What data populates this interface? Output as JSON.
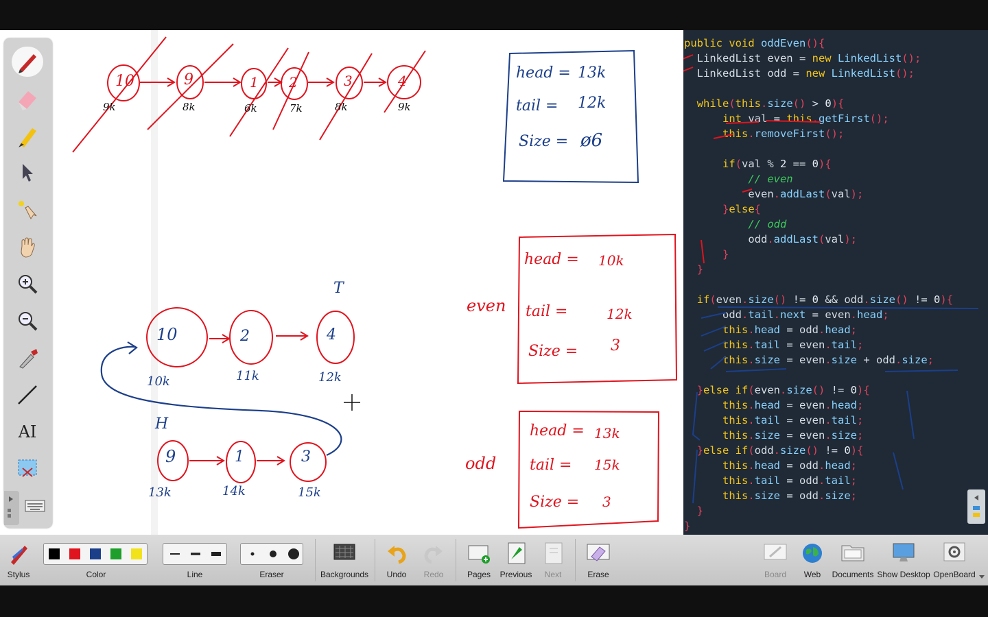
{
  "board": {
    "top_nodes": [
      {
        "value": "10",
        "addr": "9k"
      },
      {
        "value": "9",
        "addr": "8k"
      },
      {
        "value": "1",
        "addr": "6k"
      },
      {
        "value": "2",
        "addr": "7k"
      },
      {
        "value": "3",
        "addr": "8k"
      },
      {
        "value": "4",
        "addr": "9k"
      }
    ],
    "main_box": {
      "head_label": "head =",
      "head_val": "13k",
      "tail_label": "tail =",
      "tail_val": "12k",
      "size_label": "Size =",
      "size_val": "ø6"
    },
    "even_list": {
      "tail_marker": "T",
      "nodes": [
        {
          "value": "10",
          "addr": "10k"
        },
        {
          "value": "2",
          "addr": "11k"
        },
        {
          "value": "4",
          "addr": "12k"
        }
      ]
    },
    "odd_list": {
      "head_marker": "H",
      "nodes": [
        {
          "value": "9",
          "addr": "13k"
        },
        {
          "value": "1",
          "addr": "14k"
        },
        {
          "value": "3",
          "addr": "15k"
        }
      ]
    },
    "even_label": "even",
    "odd_label": "odd",
    "even_box": {
      "head_label": "head =",
      "head_val": "10k",
      "tail_label": "tail =",
      "tail_val": "12k",
      "size_label": "Size =",
      "size_val": "3"
    },
    "odd_box": {
      "head_label": "head =",
      "head_val": "13k",
      "tail_label": "tail =",
      "tail_val": "15k",
      "size_label": "Size =",
      "size_val": "3"
    }
  },
  "palette": {
    "tools": [
      "pen-icon",
      "eraser-icon",
      "marker-icon",
      "pointer-icon",
      "laser-pointer-icon",
      "hand-icon",
      "zoom-in-icon",
      "zoom-out-icon",
      "color-picker-icon",
      "line-icon",
      "text-icon",
      "capture-icon",
      "keyboard-icon"
    ],
    "text_tool_glyph": "AI"
  },
  "code": {
    "lines": [
      [
        [
          "kw",
          "public "
        ],
        [
          "ty",
          "void "
        ],
        [
          "fn",
          "oddEven"
        ],
        [
          "pu",
          "(){"
        ]
      ],
      [
        [
          "",
          "  LinkedList even = "
        ],
        [
          "kw",
          "new "
        ],
        [
          "fn",
          "LinkedList"
        ],
        [
          "pu",
          "();"
        ]
      ],
      [
        [
          "",
          "  LinkedList odd = "
        ],
        [
          "kw",
          "new "
        ],
        [
          "fn",
          "LinkedList"
        ],
        [
          "pu",
          "();"
        ]
      ],
      [
        [
          "",
          ""
        ]
      ],
      [
        [
          "kw",
          "  while"
        ],
        [
          "pu",
          "("
        ],
        [
          "kw",
          "this"
        ],
        [
          "pu",
          "."
        ],
        [
          "fn",
          "size"
        ],
        [
          "pu",
          "() "
        ],
        [
          "",
          "> "
        ],
        [
          "nu",
          "0"
        ],
        [
          "pu",
          "){"
        ]
      ],
      [
        [
          "ty",
          "      int "
        ],
        [
          "",
          "val = "
        ],
        [
          "kw",
          "this"
        ],
        [
          "pu",
          "."
        ],
        [
          "fn",
          "getFirst"
        ],
        [
          "pu",
          "();"
        ]
      ],
      [
        [
          "kw",
          "      this"
        ],
        [
          "pu",
          "."
        ],
        [
          "fn",
          "removeFirst"
        ],
        [
          "pu",
          "();"
        ]
      ],
      [
        [
          "",
          ""
        ]
      ],
      [
        [
          "kw",
          "      if"
        ],
        [
          "pu",
          "("
        ],
        [
          "",
          "val % "
        ],
        [
          "nu",
          "2"
        ],
        [
          "",
          " == "
        ],
        [
          "nu",
          "0"
        ],
        [
          "pu",
          "){"
        ]
      ],
      [
        [
          "cm",
          "          // even"
        ]
      ],
      [
        [
          "",
          "          even"
        ],
        [
          "pu",
          "."
        ],
        [
          "fn",
          "addLast"
        ],
        [
          "pu",
          "("
        ],
        [
          "",
          "val"
        ],
        [
          "pu",
          ");"
        ]
      ],
      [
        [
          "pu",
          "      }"
        ],
        [
          "kw",
          "else"
        ],
        [
          "pu",
          "{"
        ]
      ],
      [
        [
          "cm",
          "          // odd"
        ]
      ],
      [
        [
          "",
          "          odd"
        ],
        [
          "pu",
          "."
        ],
        [
          "fn",
          "addLast"
        ],
        [
          "pu",
          "("
        ],
        [
          "",
          "val"
        ],
        [
          "pu",
          ");"
        ]
      ],
      [
        [
          "pu",
          "      }"
        ]
      ],
      [
        [
          "pu",
          "  }"
        ]
      ],
      [
        [
          "",
          ""
        ]
      ],
      [
        [
          "kw",
          "  if"
        ],
        [
          "pu",
          "("
        ],
        [
          "",
          "even"
        ],
        [
          "pu",
          "."
        ],
        [
          "fn",
          "size"
        ],
        [
          "pu",
          "() "
        ],
        [
          "",
          "!= "
        ],
        [
          "nu",
          "0"
        ],
        [
          "",
          " && odd"
        ],
        [
          "pu",
          "."
        ],
        [
          "fn",
          "size"
        ],
        [
          "pu",
          "() "
        ],
        [
          "",
          "!= "
        ],
        [
          "nu",
          "0"
        ],
        [
          "pu",
          "){"
        ]
      ],
      [
        [
          "",
          "      odd"
        ],
        [
          "pu",
          "."
        ],
        [
          "fn",
          "tail"
        ],
        [
          "pu",
          "."
        ],
        [
          "fn",
          "next"
        ],
        [
          "",
          " = even"
        ],
        [
          "pu",
          "."
        ],
        [
          "fn",
          "head"
        ],
        [
          "pu",
          ";"
        ]
      ],
      [
        [
          "kw",
          "      this"
        ],
        [
          "pu",
          "."
        ],
        [
          "fn",
          "head"
        ],
        [
          "",
          " = odd"
        ],
        [
          "pu",
          "."
        ],
        [
          "fn",
          "head"
        ],
        [
          "pu",
          ";"
        ]
      ],
      [
        [
          "kw",
          "      this"
        ],
        [
          "pu",
          "."
        ],
        [
          "fn",
          "tail"
        ],
        [
          "",
          " = even"
        ],
        [
          "pu",
          "."
        ],
        [
          "fn",
          "tail"
        ],
        [
          "pu",
          ";"
        ]
      ],
      [
        [
          "kw",
          "      this"
        ],
        [
          "pu",
          "."
        ],
        [
          "fn",
          "size"
        ],
        [
          "",
          " = even"
        ],
        [
          "pu",
          "."
        ],
        [
          "fn",
          "size"
        ],
        [
          "",
          " + odd"
        ],
        [
          "pu",
          "."
        ],
        [
          "fn",
          "size"
        ],
        [
          "pu",
          ";"
        ]
      ],
      [
        [
          "",
          ""
        ]
      ],
      [
        [
          "pu",
          "  }"
        ],
        [
          "kw",
          "else if"
        ],
        [
          "pu",
          "("
        ],
        [
          "",
          "even"
        ],
        [
          "pu",
          "."
        ],
        [
          "fn",
          "size"
        ],
        [
          "pu",
          "() "
        ],
        [
          "",
          "!= "
        ],
        [
          "nu",
          "0"
        ],
        [
          "pu",
          "){"
        ]
      ],
      [
        [
          "kw",
          "      this"
        ],
        [
          "pu",
          "."
        ],
        [
          "fn",
          "head"
        ],
        [
          "",
          " = even"
        ],
        [
          "pu",
          "."
        ],
        [
          "fn",
          "head"
        ],
        [
          "pu",
          ";"
        ]
      ],
      [
        [
          "kw",
          "      this"
        ],
        [
          "pu",
          "."
        ],
        [
          "fn",
          "tail"
        ],
        [
          "",
          " = even"
        ],
        [
          "pu",
          "."
        ],
        [
          "fn",
          "tail"
        ],
        [
          "pu",
          ";"
        ]
      ],
      [
        [
          "kw",
          "      this"
        ],
        [
          "pu",
          "."
        ],
        [
          "fn",
          "size"
        ],
        [
          "",
          " = even"
        ],
        [
          "pu",
          "."
        ],
        [
          "fn",
          "size"
        ],
        [
          "pu",
          ";"
        ]
      ],
      [
        [
          "pu",
          "  }"
        ],
        [
          "kw",
          "else if"
        ],
        [
          "pu",
          "("
        ],
        [
          "",
          "odd"
        ],
        [
          "pu",
          "."
        ],
        [
          "fn",
          "size"
        ],
        [
          "pu",
          "() "
        ],
        [
          "",
          "!= "
        ],
        [
          "nu",
          "0"
        ],
        [
          "pu",
          "){"
        ]
      ],
      [
        [
          "kw",
          "      this"
        ],
        [
          "pu",
          "."
        ],
        [
          "fn",
          "head"
        ],
        [
          "",
          " = odd"
        ],
        [
          "pu",
          "."
        ],
        [
          "fn",
          "head"
        ],
        [
          "pu",
          ";"
        ]
      ],
      [
        [
          "kw",
          "      this"
        ],
        [
          "pu",
          "."
        ],
        [
          "fn",
          "tail"
        ],
        [
          "",
          " = odd"
        ],
        [
          "pu",
          "."
        ],
        [
          "fn",
          "tail"
        ],
        [
          "pu",
          ";"
        ]
      ],
      [
        [
          "kw",
          "      this"
        ],
        [
          "pu",
          "."
        ],
        [
          "fn",
          "size"
        ],
        [
          "",
          " = odd"
        ],
        [
          "pu",
          "."
        ],
        [
          "fn",
          "size"
        ],
        [
          "pu",
          ";"
        ]
      ],
      [
        [
          "pu",
          "  }"
        ]
      ],
      [
        [
          "pu",
          "}"
        ]
      ]
    ]
  },
  "toolbar": {
    "stylus": "Stylus",
    "color": "Color",
    "colors": [
      "#000000",
      "#e0141e",
      "#1c3f8a",
      "#1e9e2a",
      "#f2e21c"
    ],
    "line": "Line",
    "eraser": "Eraser",
    "backgrounds": "Backgrounds",
    "undo": "Undo",
    "redo": "Redo",
    "pages": "Pages",
    "previous": "Previous",
    "next": "Next",
    "erase": "Erase",
    "board": "Board",
    "web": "Web",
    "documents": "Documents",
    "show_desktop": "Show Desktop",
    "openboard": "OpenBoard"
  }
}
